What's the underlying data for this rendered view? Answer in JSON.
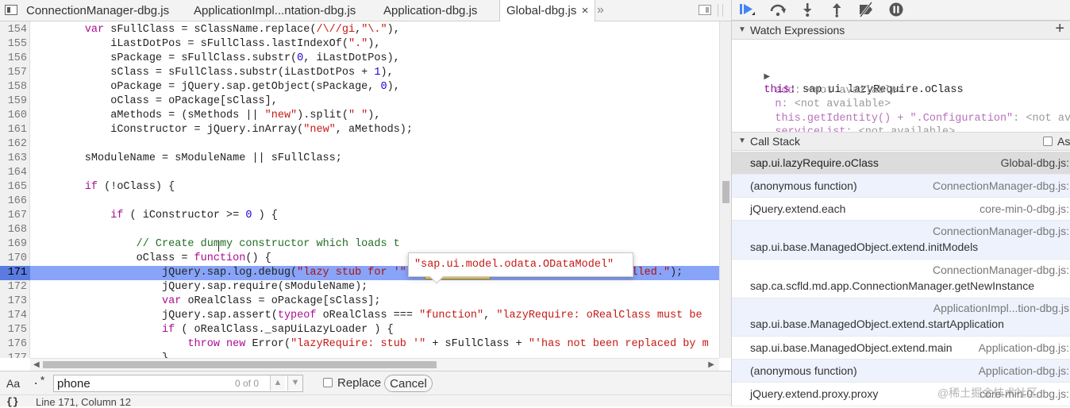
{
  "tabs": [
    {
      "label": "ConnectionManager-dbg.js",
      "active": false
    },
    {
      "label": "ApplicationImpl...ntation-dbg.js",
      "active": false
    },
    {
      "label": "Application-dbg.js",
      "active": false
    },
    {
      "label": "Global-dbg.js",
      "active": true
    }
  ],
  "tab_close_glyph": "×",
  "tabs_overflow_glyph": "»",
  "editor": {
    "lines": [
      {
        "no": "154"
      },
      {
        "no": "155"
      },
      {
        "no": "156"
      },
      {
        "no": "157"
      },
      {
        "no": "158"
      },
      {
        "no": "159"
      },
      {
        "no": "160"
      },
      {
        "no": "161"
      },
      {
        "no": "162"
      },
      {
        "no": "163"
      },
      {
        "no": "164"
      },
      {
        "no": "165"
      },
      {
        "no": "166"
      },
      {
        "no": "167"
      },
      {
        "no": "168"
      },
      {
        "no": "169"
      },
      {
        "no": "170"
      },
      {
        "no": "171"
      },
      {
        "no": "172"
      },
      {
        "no": "173"
      },
      {
        "no": "174"
      },
      {
        "no": "175"
      },
      {
        "no": "176"
      },
      {
        "no": "177"
      }
    ],
    "current_line": "171",
    "popover_value": "\"sap.ui.model.odata.ODataModel\""
  },
  "search": {
    "case_label": "Aa",
    "regex_label": ".*",
    "query": "phone",
    "match_count": "0 of 0",
    "replace_label": "Replace",
    "cancel_label": "Cancel"
  },
  "status": {
    "icon": "{}",
    "position": "Line 171, Column 12"
  },
  "watch": {
    "title": "Watch Expressions",
    "add_glyph": "+",
    "root_expr": "this",
    "root_value": "sap.ui.lazyRequire.oClass",
    "items": [
      {
        "name": "add",
        "value": "<not available>"
      },
      {
        "name": "n",
        "value": "<not available>"
      },
      {
        "name": "this.getIdentity() + \".Configuration\"",
        "value": "<not available>"
      },
      {
        "name": "serviceList",
        "value": "<not available>"
      }
    ]
  },
  "callstack": {
    "title": "Call Stack",
    "async_label": "Async",
    "frames": [
      {
        "fn": "sap.ui.lazyRequire.oClass",
        "file": "Global-dbg.js:"
      },
      {
        "fn": "(anonymous function)",
        "file": "ConnectionManager-dbg.js:"
      },
      {
        "fn": "jQuery.extend.each",
        "file": "core-min-0-dbg.js:"
      },
      {
        "fn": "sap.ui.base.ManagedObject.extend.initModels",
        "file": "ConnectionManager-dbg.js:"
      },
      {
        "fn": "sap.ca.scfld.md.app.ConnectionManager.getNewInstance",
        "file": "ConnectionManager-dbg.js:"
      },
      {
        "fn": "sap.ui.base.ManagedObject.extend.startApplication",
        "file": "ApplicationImpl...tion-dbg.js"
      },
      {
        "fn": "sap.ui.base.ManagedObject.extend.main",
        "file": "Application-dbg.js:"
      },
      {
        "fn": "(anonymous function)",
        "file": "Application-dbg.js:"
      },
      {
        "fn": "jQuery.extend.proxy.proxy",
        "file": "core-min-0-dbg.js:"
      }
    ]
  },
  "watermark": "@稀土掘金技术社区",
  "colors": {
    "exec_line": "#88a4f8",
    "exec_gutter": "#5b7be0",
    "keyword": "#aa0d91",
    "string": "#c41a16",
    "number": "#1c00cf",
    "comment": "#236e25",
    "debugger_blue": "#4285f4"
  }
}
